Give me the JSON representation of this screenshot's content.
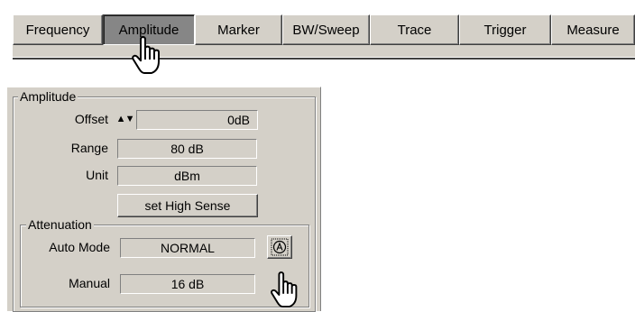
{
  "toolbar": {
    "tabs": [
      {
        "label": "Frequency",
        "active": false
      },
      {
        "label": "Amplitude",
        "active": true
      },
      {
        "label": "Marker",
        "active": false
      },
      {
        "label": "BW/Sweep",
        "active": false
      },
      {
        "label": "Trace",
        "active": false
      },
      {
        "label": "Trigger",
        "active": false
      },
      {
        "label": "Measure",
        "active": false
      }
    ]
  },
  "panel": {
    "group_title": "Amplitude",
    "offset": {
      "label": "Offset",
      "value": "0dB",
      "spin_up": "▲",
      "spin_down": "▼"
    },
    "range": {
      "label": "Range",
      "value": "80 dB"
    },
    "unit": {
      "label": "Unit",
      "value": "dBm"
    },
    "high_sense_button": "set High Sense",
    "attenuation": {
      "group_title": "Attenuation",
      "auto_mode": {
        "label": "Auto Mode",
        "value": "NORMAL",
        "button_icon": "auto-a-icon"
      },
      "manual": {
        "label": "Manual",
        "value": "16 dB"
      }
    }
  },
  "colors": {
    "face": "#d4d0c8",
    "active_tab": "#868686",
    "shadow": "#808080",
    "highlight": "#ffffff"
  }
}
